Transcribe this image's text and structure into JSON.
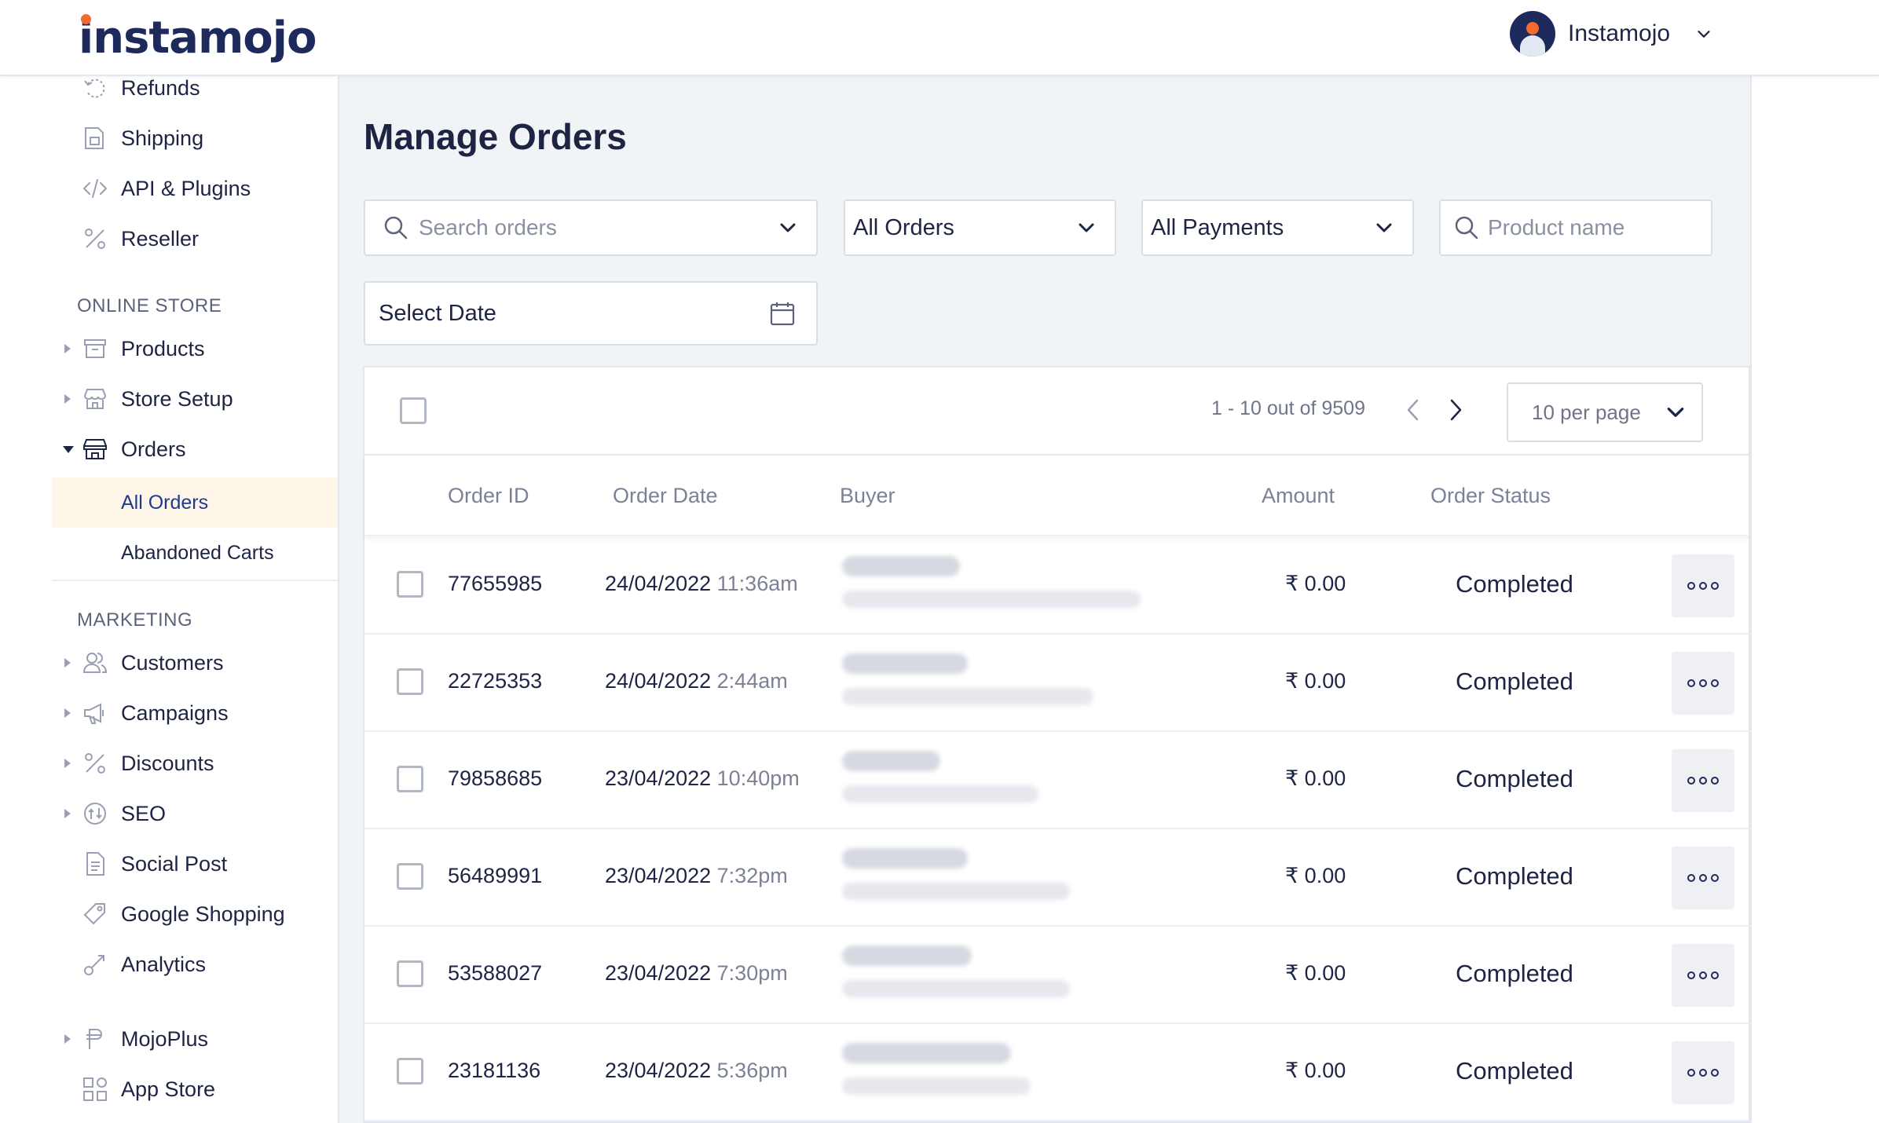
{
  "header": {
    "logo_text": "instamojo",
    "account_name": "Instamojo",
    "colors": {
      "brand": "#1f2a5c",
      "logo_dot": "#f26a2e"
    }
  },
  "sidebar": {
    "top_items": [
      {
        "label": "Refunds",
        "icon": "refund-icon"
      },
      {
        "label": "Shipping",
        "icon": "shipping-icon"
      },
      {
        "label": "API & Plugins",
        "icon": "code-icon"
      },
      {
        "label": "Reseller",
        "icon": "percent-icon"
      }
    ],
    "online_store": {
      "title": "ONLINE STORE",
      "items": [
        {
          "label": "Products",
          "icon": "products-icon",
          "expandable": true
        },
        {
          "label": "Store Setup",
          "icon": "store-icon",
          "expandable": true
        },
        {
          "label": "Orders",
          "icon": "orders-icon",
          "expanded": true
        }
      ],
      "sub_items": [
        {
          "label": "All Orders",
          "active": true
        },
        {
          "label": "Abandoned Carts",
          "active": false
        }
      ]
    },
    "marketing": {
      "title": "MARKETING",
      "items": [
        {
          "label": "Customers",
          "icon": "customers-icon",
          "expandable": true
        },
        {
          "label": "Campaigns",
          "icon": "megaphone-icon",
          "expandable": true
        },
        {
          "label": "Discounts",
          "icon": "percent-icon",
          "expandable": true
        },
        {
          "label": "SEO",
          "icon": "seo-icon",
          "expandable": true
        },
        {
          "label": "Social Post",
          "icon": "document-icon"
        },
        {
          "label": "Google Shopping",
          "icon": "tag-icon"
        },
        {
          "label": "Analytics",
          "icon": "analytics-icon"
        }
      ]
    },
    "bottom_items": [
      {
        "label": "MojoPlus",
        "icon": "mojoplus-icon",
        "expandable": true
      },
      {
        "label": "App Store",
        "icon": "app-store-icon"
      }
    ]
  },
  "main": {
    "title": "Manage Orders",
    "filters": {
      "search_placeholder": "Search orders",
      "orders_filter": "All Orders",
      "payments_filter": "All Payments",
      "product_placeholder": "Product name",
      "date_label": "Select Date"
    },
    "pagination": {
      "range": "1 - 10 out of 9509",
      "per_page": "10 per page"
    },
    "table": {
      "columns": [
        "Order ID",
        "Order Date",
        "Buyer",
        "Amount",
        "Order Status"
      ],
      "rows": [
        {
          "order_id": "77655985",
          "date": "24/04/2022",
          "time": "11:36am",
          "amount": "₹ 0.00",
          "status": "Completed"
        },
        {
          "order_id": "22725353",
          "date": "24/04/2022",
          "time": "2:44am",
          "amount": "₹ 0.00",
          "status": "Completed"
        },
        {
          "order_id": "79858685",
          "date": "23/04/2022",
          "time": "10:40pm",
          "amount": "₹ 0.00",
          "status": "Completed"
        },
        {
          "order_id": "56489991",
          "date": "23/04/2022",
          "time": "7:32pm",
          "amount": "₹ 0.00",
          "status": "Completed"
        },
        {
          "order_id": "53588027",
          "date": "23/04/2022",
          "time": "7:30pm",
          "amount": "₹ 0.00",
          "status": "Completed"
        },
        {
          "order_id": "23181136",
          "date": "23/04/2022",
          "time": "5:36pm",
          "amount": "₹ 0.00",
          "status": "Completed"
        }
      ]
    }
  }
}
